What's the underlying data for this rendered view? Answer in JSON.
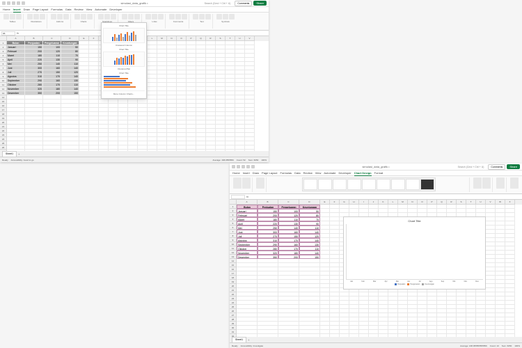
{
  "titlebar": {
    "filename": "simulasi_data_grafik •",
    "search": "Search (Cmd + Ctrl + U)",
    "comments": "Comments",
    "share": "Share"
  },
  "tabs1": [
    "Home",
    "Insert",
    "Draw",
    "Page Layout",
    "Formulas",
    "Data",
    "Review",
    "View",
    "Automate",
    "Developer"
  ],
  "tabs1_active": 1,
  "tabs2": [
    "Home",
    "Insert",
    "Draw",
    "Page Layout",
    "Formulas",
    "Data",
    "Review",
    "View",
    "Automate",
    "Developer",
    "Chart Design",
    "Format"
  ],
  "tabs2_active": 10,
  "ribbon1_groups": [
    "Tables",
    "Illustrations",
    "Add-ins",
    "Charts",
    "Sparklines",
    "Filters",
    "Links",
    "Comments",
    "Text",
    "Symbols"
  ],
  "ribbon2_groups": [
    "Chart Layouts",
    "Chart Styles",
    "Data",
    "Type",
    "Location"
  ],
  "chartpicker": {
    "s1": "Clustered Column",
    "s2": "Clustered Bar",
    "s3": "More Column Charts...",
    "title": "Chart Title"
  },
  "namebox": "A1",
  "columns": [
    "A",
    "B",
    "C",
    "D",
    "E",
    "F",
    "G",
    "H",
    "I",
    "J",
    "K",
    "L",
    "M",
    "N",
    "O",
    "P",
    "Q",
    "R",
    "S",
    "T",
    "U",
    "V",
    "W",
    "X",
    "Y",
    "Z",
    "AA"
  ],
  "table": {
    "headers": [
      "Bulan",
      "Penjualan",
      "Pengeluaran",
      "Keuntungan"
    ],
    "rows": [
      [
        "Januari",
        "150",
        "100",
        "50"
      ],
      [
        "Februari",
        "200",
        "120",
        "80"
      ],
      [
        "Maret",
        "180",
        "110",
        "70"
      ],
      [
        "April",
        "220",
        "130",
        "90"
      ],
      [
        "Mei",
        "250",
        "140",
        "110"
      ],
      [
        "Juni",
        "300",
        "160",
        "140"
      ],
      [
        "Juli",
        "270",
        "150",
        "120"
      ],
      [
        "Agustus",
        "310",
        "170",
        "140"
      ],
      [
        "September",
        "290",
        "160",
        "130"
      ],
      [
        "Oktober",
        "280",
        "170",
        "110"
      ],
      [
        "November",
        "320",
        "180",
        "140"
      ],
      [
        "Desember",
        "350",
        "200",
        "150"
      ]
    ]
  },
  "chart": {
    "title": "Chart Title",
    "legend": [
      "Penjualan",
      "Pengeluaran",
      "Keuntungan"
    ]
  },
  "chart_data": {
    "type": "bar",
    "categories": [
      "Januari",
      "Februari",
      "Maret",
      "April",
      "Mei",
      "Juni",
      "Juli",
      "Agustus",
      "September",
      "Oktober",
      "November",
      "Desember"
    ],
    "series": [
      {
        "name": "Penjualan",
        "values": [
          150,
          200,
          180,
          220,
          250,
          300,
          270,
          310,
          290,
          280,
          320,
          350
        ]
      },
      {
        "name": "Pengeluaran",
        "values": [
          100,
          120,
          110,
          130,
          140,
          160,
          150,
          170,
          160,
          170,
          180,
          200
        ]
      },
      {
        "name": "Keuntungan",
        "values": [
          50,
          80,
          70,
          90,
          110,
          140,
          120,
          140,
          130,
          110,
          140,
          150
        ]
      }
    ],
    "ylim": [
      0,
      400
    ]
  },
  "status": {
    "ready": "Ready",
    "access": "Accessibility: Good to go",
    "access2": "Accessibility: Investigate",
    "avg": "Average: 168.0555556",
    "avg2": "Average: 168.055555555556",
    "count": "Count: 52",
    "count2": "Count: 13",
    "sum": "Sum: 6050",
    "zoom": "100%"
  },
  "sheet": "Sheet1"
}
